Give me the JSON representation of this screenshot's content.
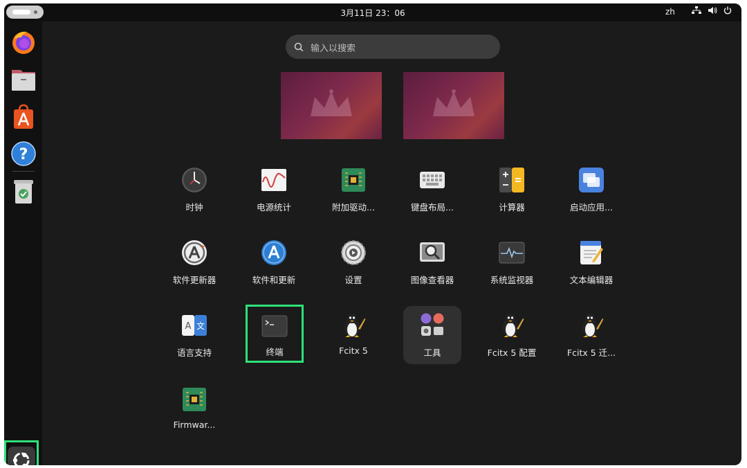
{
  "topbar": {
    "clock": "3月11日  23：06",
    "lang": "zh",
    "tray": [
      "network-icon",
      "volume-icon",
      "power-icon"
    ]
  },
  "dock": {
    "items": [
      "Firefox",
      "Files",
      "App Center",
      "Help",
      "Trash"
    ],
    "show_apps": "show-applications"
  },
  "search": {
    "placeholder": "输入以搜索"
  },
  "apps": {
    "row1": [
      "时钟",
      "电源统计",
      "附加驱动...",
      "键盘布局...",
      "计算器",
      "启动应用..."
    ],
    "row2": [
      "软件更新器",
      "软件和更新",
      "设置",
      "图像查看器",
      "系统监视器",
      "文本编辑器"
    ],
    "row3": [
      "语言支持",
      "终端",
      "Fcitx 5",
      "工具",
      "Fcitx 5 配置",
      "Fcitx 5 迁..."
    ],
    "row4": [
      "Firmwar..."
    ]
  },
  "colors": {
    "highlight": "#2ee27a",
    "background": "#1b1b1b",
    "accent": "#e95420"
  }
}
